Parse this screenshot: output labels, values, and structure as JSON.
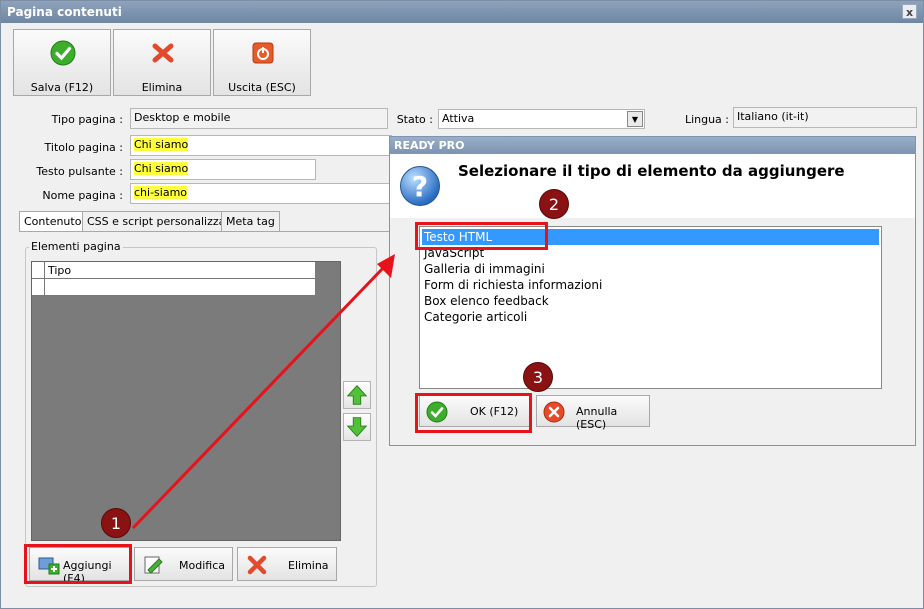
{
  "window": {
    "title": "Pagina contenuti",
    "close_glyph": "x"
  },
  "toolbar": {
    "save_label": "Salva (F12)",
    "delete_label": "Elimina",
    "exit_label": "Uscita (ESC)"
  },
  "form": {
    "tipo_pagina_label": "Tipo pagina :",
    "tipo_pagina_value": "Desktop e mobile",
    "stato_label": "Stato :",
    "stato_value": "Attiva",
    "lingua_label": "Lingua :",
    "lingua_value": "Italiano (it-it)",
    "titolo_label": "Titolo pagina :",
    "titolo_value": "Chi siamo",
    "testo_pulsante_label": "Testo pulsante :",
    "testo_pulsante_value": "Chi siamo",
    "nome_pagina_label": "Nome pagina :",
    "nome_pagina_value": "chi-siamo"
  },
  "tabs": [
    {
      "label": "Contenuto"
    },
    {
      "label": "CSS e script personalizzati"
    },
    {
      "label": "Meta tag"
    }
  ],
  "elements_panel": {
    "group_title": "Elementi pagina",
    "column_header": "Tipo"
  },
  "bottom_buttons": {
    "add_label": "Aggiungi (F4)",
    "edit_label": "Modifica",
    "delete_label": "Elimina"
  },
  "dialog": {
    "title": "READY PRO",
    "heading": "Selezionare il tipo di elemento da aggiungere",
    "items": [
      {
        "label": "Testo HTML",
        "selected": true
      },
      {
        "label": "JavaScript",
        "selected": false
      },
      {
        "label": "Galleria di immagini",
        "selected": false
      },
      {
        "label": "Form di richiesta informazioni",
        "selected": false
      },
      {
        "label": "Box elenco feedback",
        "selected": false
      },
      {
        "label": "Categorie articoli",
        "selected": false
      }
    ],
    "ok_label": "OK (F12)",
    "cancel_label": "Annulla (ESC)"
  },
  "annotations": {
    "step1": "1",
    "step2": "2",
    "step3": "3",
    "color": "#e8121a"
  },
  "icons": {
    "save": "check-icon",
    "delete": "cross-icon",
    "exit": "power-icon",
    "help": "question-icon"
  }
}
